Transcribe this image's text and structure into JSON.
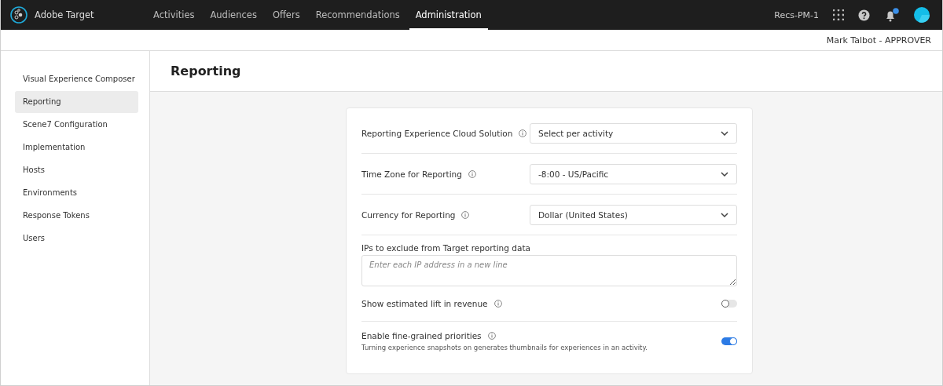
{
  "app": {
    "name": "Adobe Target"
  },
  "nav": [
    {
      "label": "Activities",
      "selected": false
    },
    {
      "label": "Audiences",
      "selected": false
    },
    {
      "label": "Offers",
      "selected": false
    },
    {
      "label": "Recommendations",
      "selected": false
    },
    {
      "label": "Administration",
      "selected": true
    }
  ],
  "workspace": "Recs-PM-1",
  "notifications": {
    "unread": true
  },
  "user": "Mark Talbot - APPROVER",
  "sidebar": {
    "items": [
      {
        "label": "Visual Experience Composer",
        "selected": false
      },
      {
        "label": "Reporting",
        "selected": true
      },
      {
        "label": "Scene7 Configuration",
        "selected": false
      },
      {
        "label": "Implementation",
        "selected": false
      },
      {
        "label": "Hosts",
        "selected": false
      },
      {
        "label": "Environments",
        "selected": false
      },
      {
        "label": "Response Tokens",
        "selected": false
      },
      {
        "label": "Users",
        "selected": false
      }
    ]
  },
  "page": {
    "title": "Reporting"
  },
  "settings": [
    {
      "kind": "select",
      "label": "Reporting Experience Cloud Solution",
      "info": true,
      "value": "Select per activity"
    },
    {
      "kind": "select",
      "label": "Time Zone for Reporting",
      "info": true,
      "value": "-8:00 - US/Pacific"
    },
    {
      "kind": "select",
      "label": "Currency for Reporting",
      "info": true,
      "value": "Dollar (United States)"
    },
    {
      "kind": "textarea",
      "label": "IPs to exclude from Target reporting data",
      "info": false,
      "placeholder": "Enter each IP address in a new line"
    },
    {
      "kind": "toggle",
      "label": "Show estimated lift in revenue",
      "info": true,
      "on": false
    },
    {
      "kind": "toggle",
      "label": "Enable fine-grained priorities",
      "info": true,
      "on": true,
      "description": "Turning experience snapshots on generates thumbnails for experiences in an activity."
    }
  ]
}
